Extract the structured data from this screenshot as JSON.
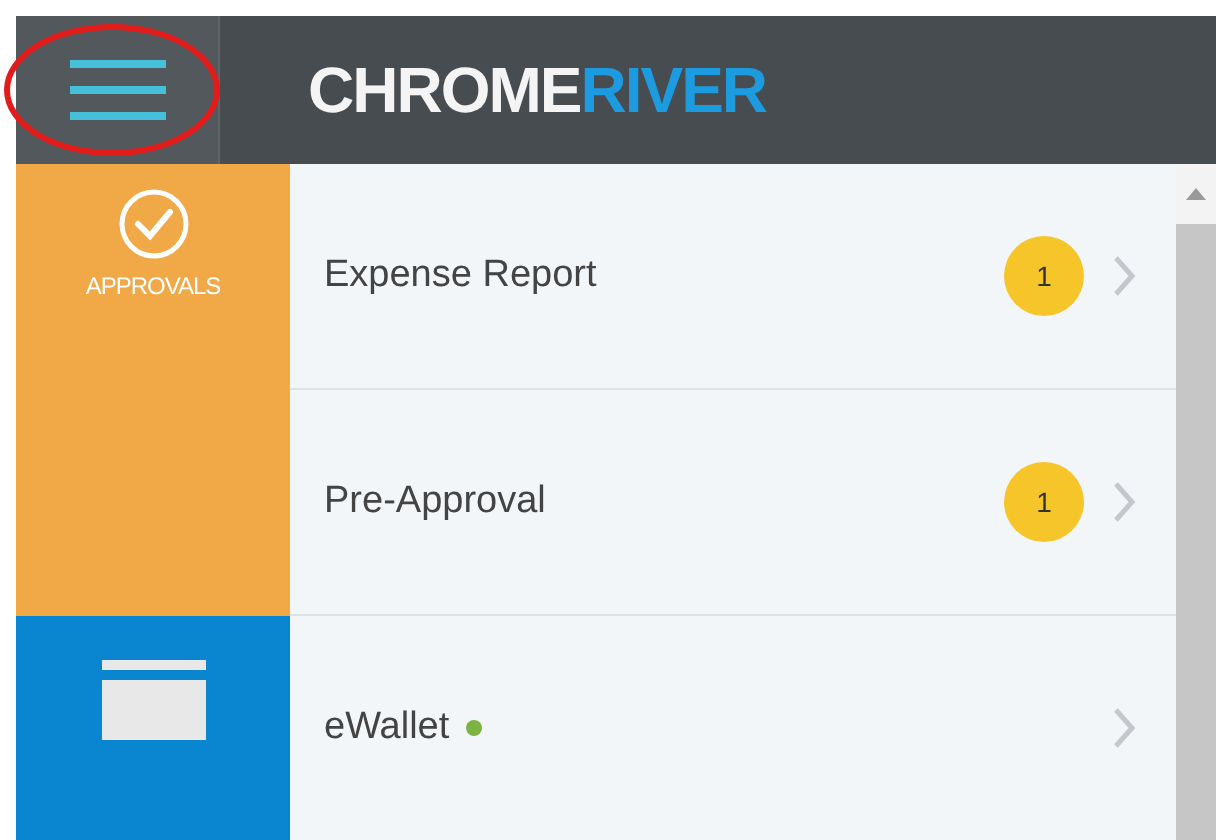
{
  "header": {
    "menu_button": {
      "highlighted": true
    },
    "logo": [
      "CHROME",
      "RIVER"
    ]
  },
  "sidebar": {
    "items": [
      {
        "kind": "approvals",
        "label": "APPROVALS",
        "color": "#f0a946"
      },
      {
        "kind": "wallet",
        "color": "#0a86d0"
      }
    ]
  },
  "list": {
    "rows": [
      {
        "label": "Expense Report",
        "badge": "1"
      },
      {
        "label": "Pre-Approval",
        "badge": "1"
      },
      {
        "label": "eWallet",
        "color": "#7cb342"
      }
    ]
  }
}
